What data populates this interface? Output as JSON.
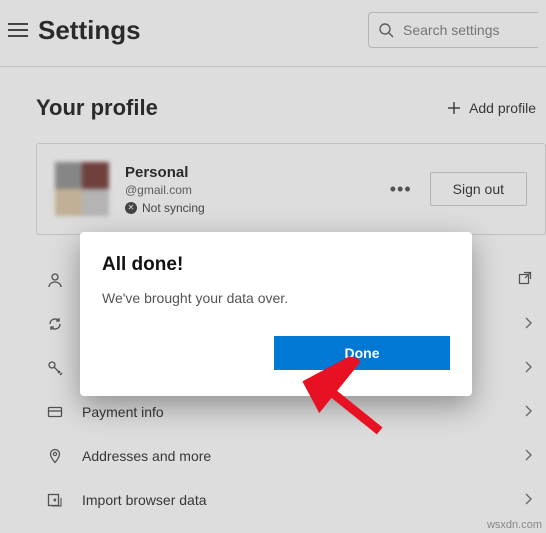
{
  "header": {
    "title": "Settings",
    "search_placeholder": "Search settings"
  },
  "profile_section": {
    "heading": "Your profile",
    "add_profile_label": "Add profile",
    "card": {
      "name": "Personal",
      "email": "@gmail.com",
      "sync_status": "Not syncing",
      "signout_label": "Sign out"
    }
  },
  "menu": {
    "items": [
      {
        "label": "",
        "trailing": "external"
      },
      {
        "label": "Sync",
        "trailing": "chevron"
      },
      {
        "label": "",
        "trailing": "chevron"
      },
      {
        "label": "Payment info",
        "trailing": "chevron"
      },
      {
        "label": "Addresses and more",
        "trailing": "chevron"
      },
      {
        "label": "Import browser data",
        "trailing": "chevron"
      }
    ]
  },
  "dialog": {
    "title": "All done!",
    "body": "We've brought your data over.",
    "primary_button": "Done"
  },
  "watermark": "wsxdn.com"
}
